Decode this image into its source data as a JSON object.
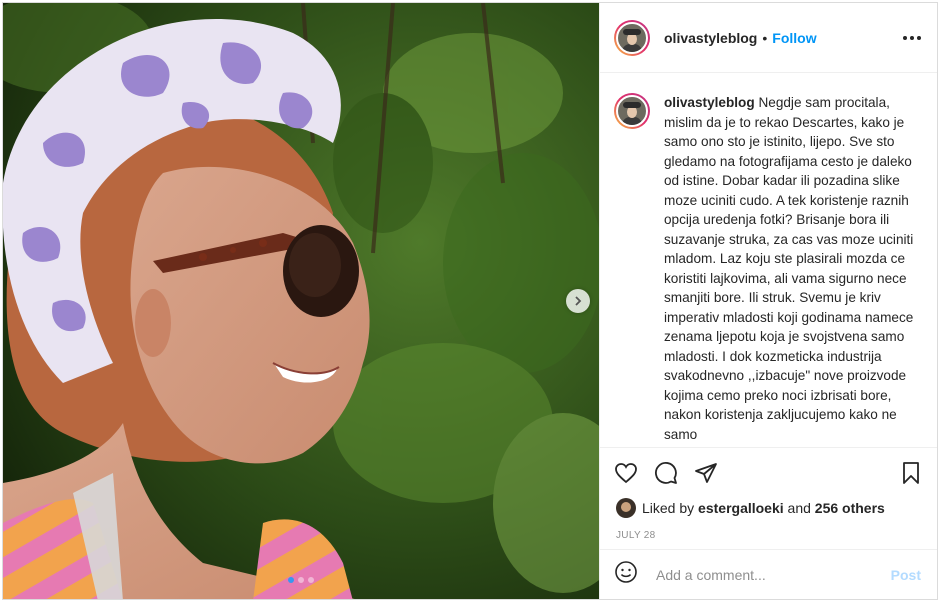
{
  "post": {
    "username": "olivastyleblog",
    "follow_label": "Follow",
    "separator": "•",
    "more_icon": "more-horizontal-icon"
  },
  "caption": {
    "username": "olivastyleblog",
    "text": "Negdje sam procitala, mislim da je to rekao Descartes, kako je samo ono sto je istinito, lijepo. Sve sto gledamo na fotografijama cesto je daleko od istine. Dobar kadar ili pozadina slike moze uciniti cudo. A tek koristenje raznih opcija uredenja fotki? Brisanje bora ili suzavanje struka, za cas vas moze uciniti mladom. Laz koju ste plasirali mozda ce koristiti lajkovima, ali vama sigurno nece smanjiti bore. Ili struk. Svemu je kriv imperativ mladosti koji godinama namece zenama ljepotu koja je svojstvena samo mladosti. I dok kozmeticka industrija svakodnevno ,,izbacuje\" nove proizvode kojima cemo preko noci izbrisati bore, nakon koristenja zakljucujemo kako ne samo"
  },
  "actions": {
    "like_icon": "heart-icon",
    "comment_icon": "comment-icon",
    "share_icon": "share-icon",
    "save_icon": "bookmark-icon"
  },
  "likes": {
    "prefix": "Liked by",
    "user": "estergalloeki",
    "middle": "and",
    "others": "256 others"
  },
  "date": "JULY 28",
  "comment": {
    "placeholder": "Add a comment...",
    "post_label": "Post",
    "emoji_icon": "smiley-icon"
  },
  "carousel": {
    "total": 3,
    "active": 1
  },
  "colors": {
    "link": "#0095f6",
    "post_disabled": "#b3dbff",
    "carousel_active": "#3897f0"
  }
}
